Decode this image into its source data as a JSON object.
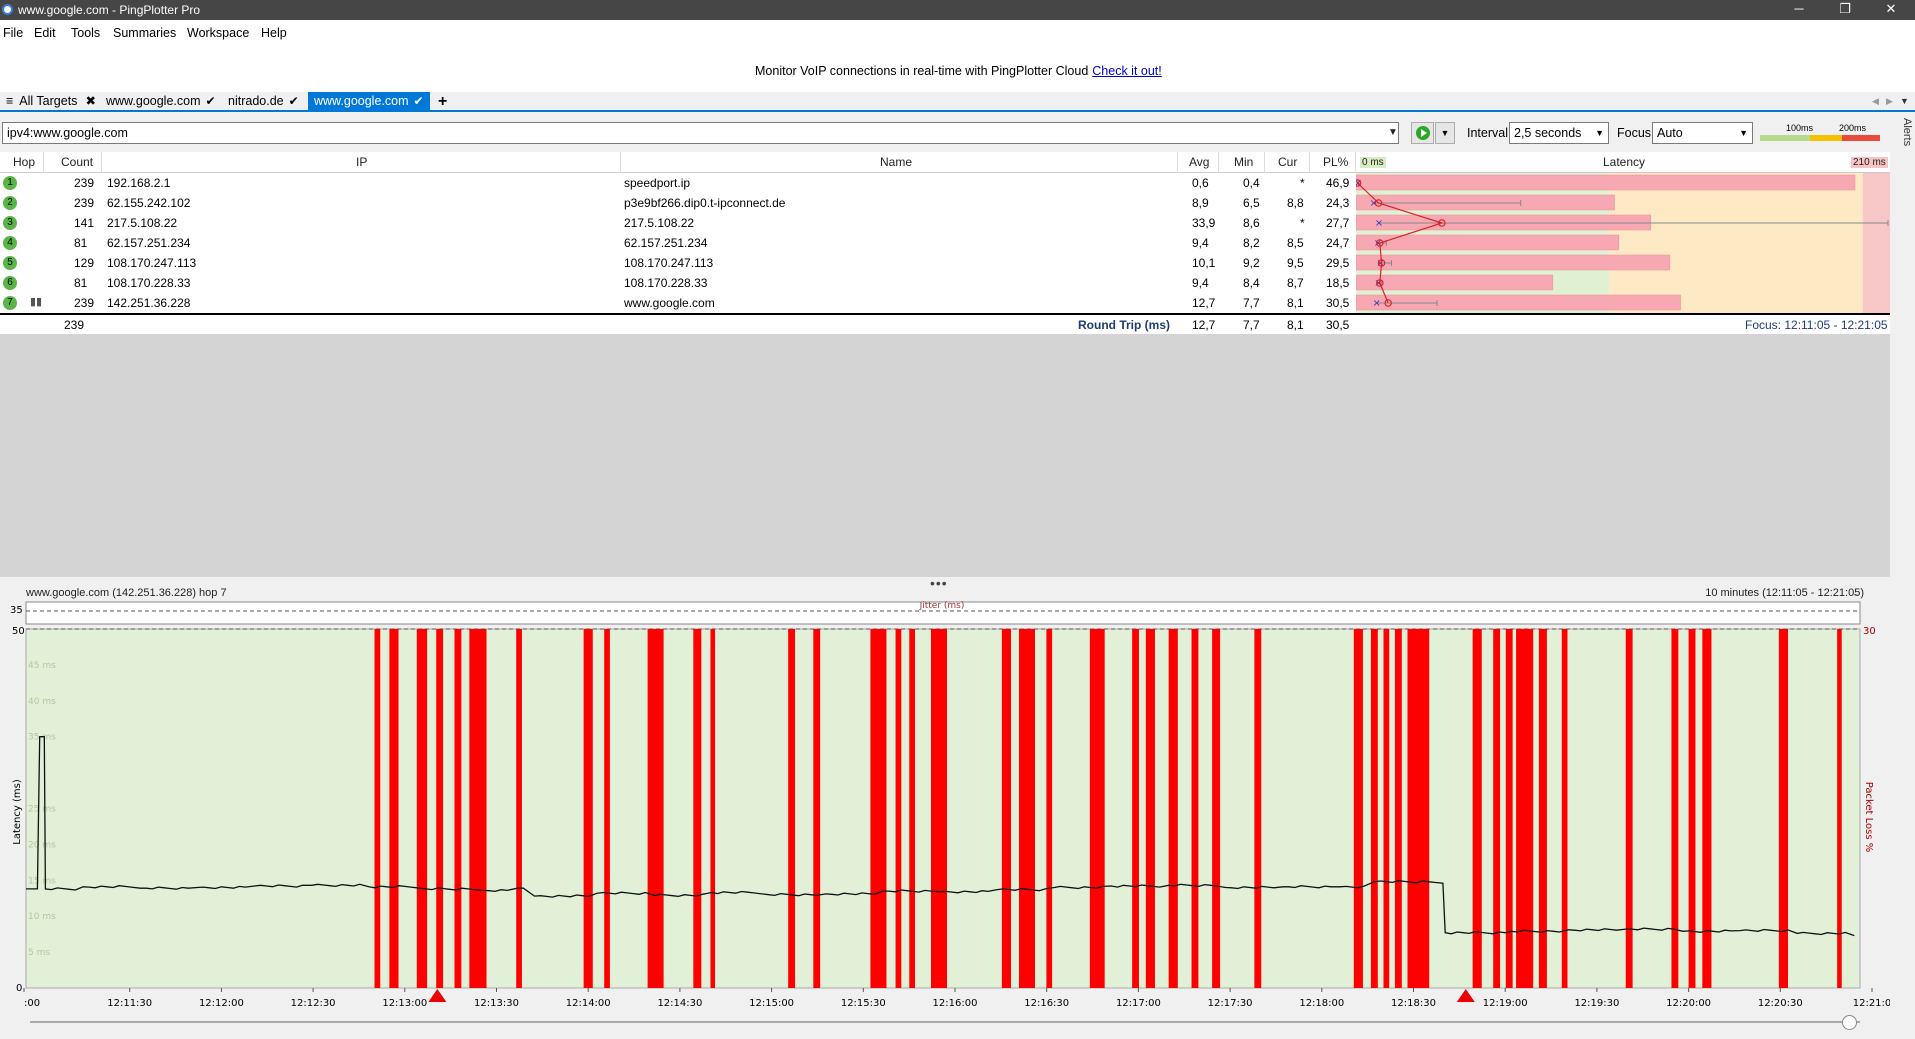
{
  "window": {
    "title": "www.google.com - PingPlotter Pro",
    "minimize": "─",
    "maximize": "❐",
    "close": "✕"
  },
  "menu": [
    "File",
    "Edit",
    "Tools",
    "Summaries",
    "Workspace",
    "Help"
  ],
  "banner": {
    "text": "Monitor VoIP connections in real-time with PingPlotter Cloud",
    "link": "Check it out!"
  },
  "tabs": {
    "all_targets": "All Targets",
    "items": [
      {
        "label": "www.google.com",
        "active": false
      },
      {
        "label": "nitrado.de",
        "active": false
      },
      {
        "label": "www.google.com",
        "active": true
      }
    ],
    "add": "+"
  },
  "target": {
    "value": "ipv4:www.google.com",
    "interval_label": "Interval",
    "interval_value": "2,5 seconds",
    "focus_label": "Focus",
    "focus_value": "Auto",
    "legend_100": "100ms",
    "legend_200": "200ms"
  },
  "alerts_label": "Alerts",
  "table": {
    "headers": {
      "hop": "Hop",
      "count": "Count",
      "ip": "IP",
      "name": "Name",
      "avg": "Avg",
      "min": "Min",
      "cur": "Cur",
      "pl": "PL%",
      "zero_ms": "0 ms",
      "latency": "Latency",
      "max_ms": "210 ms"
    },
    "rows": [
      {
        "hop": "1",
        "count": "239",
        "ip": "192.168.2.1",
        "name": "speedport.ip",
        "avg": "0,6",
        "min": "0,4",
        "cur": "*",
        "pl": "46,9",
        "avg_ms": 0.6,
        "min_ms": 0.4,
        "max_ms": 1.0,
        "pl_pct": 46.9
      },
      {
        "hop": "2",
        "count": "239",
        "ip": "62.155.242.102",
        "name": "p3e9bf266.dip0.t-ipconnect.de",
        "avg": "8,9",
        "min": "6,5",
        "cur": "8,8",
        "pl": "24,3",
        "avg_ms": 8.9,
        "min_ms": 6.5,
        "max_ms": 65,
        "pl_pct": 24.3
      },
      {
        "hop": "3",
        "count": "141",
        "ip": "217.5.108.22",
        "name": "217.5.108.22",
        "avg": "33,9",
        "min": "8,6",
        "cur": "*",
        "pl": "27,7",
        "avg_ms": 33.9,
        "min_ms": 8.6,
        "max_ms": 210,
        "pl_pct": 27.7
      },
      {
        "hop": "4",
        "count": "81",
        "ip": "62.157.251.234",
        "name": "62.157.251.234",
        "avg": "9,4",
        "min": "8,2",
        "cur": "8,5",
        "pl": "24,7",
        "avg_ms": 9.4,
        "min_ms": 8.2,
        "max_ms": 12,
        "pl_pct": 24.7
      },
      {
        "hop": "5",
        "count": "129",
        "ip": "108.170.247.113",
        "name": "108.170.247.113",
        "avg": "10,1",
        "min": "9,2",
        "cur": "9,5",
        "pl": "29,5",
        "avg_ms": 10.1,
        "min_ms": 9.2,
        "max_ms": 14,
        "pl_pct": 29.5
      },
      {
        "hop": "6",
        "count": "81",
        "ip": "108.170.228.33",
        "name": "108.170.228.33",
        "avg": "9,4",
        "min": "8,4",
        "cur": "8,7",
        "pl": "18,5",
        "avg_ms": 9.4,
        "min_ms": 8.4,
        "max_ms": 10,
        "pl_pct": 18.5
      },
      {
        "hop": "7",
        "count": "239",
        "ip": "142.251.36.228",
        "name": "www.google.com",
        "avg": "12,7",
        "min": "7,7",
        "cur": "8,1",
        "pl": "30,5",
        "avg_ms": 12.7,
        "min_ms": 7.7,
        "max_ms": 32,
        "pl_pct": 30.5
      }
    ],
    "total": {
      "count": "239",
      "label": "Round Trip (ms)",
      "avg": "12,7",
      "min": "7,7",
      "cur": "8,1",
      "pl": "30,5",
      "focus": "Focus: 12:11:05 - 12:21:05"
    }
  },
  "graph": {
    "title": "www.google.com (142.251.36.228) hop 7",
    "range": "10 minutes (12:11:05 - 12:21:05)",
    "jitter_label": "Jitter (ms)",
    "jitter_max": "35",
    "latency_axis_label": "Latency (ms)",
    "pl_axis_label": "Packet Loss %",
    "pl_axis_max": "30",
    "y_ticks": [
      "50",
      "0"
    ],
    "y_minor": [
      "45 ms",
      "40 ms",
      "35 ms",
      "25 ms",
      "20 ms",
      "15 ms",
      "10 ms",
      "5 ms"
    ],
    "x_labels": [
      ":00",
      "12:11:30",
      "12:12:00",
      "12:12:30",
      "12:13:00",
      "12:13:30",
      "12:14:00",
      "12:14:30",
      "12:15:00",
      "12:15:30",
      "12:16:00",
      "12:16:30",
      "12:17:00",
      "12:17:30",
      "12:18:00",
      "12:18:30",
      "12:19:00",
      "12:19:30",
      "12:20:00",
      "12:20:30",
      "12:21:0"
    ]
  },
  "chart_data": {
    "type": "bar",
    "title": "www.google.com (142.251.36.228) hop 7",
    "xlabel": "",
    "ylabel": "Latency (ms)",
    "ylim": [
      0,
      50
    ],
    "x_range": [
      "12:11:05",
      "12:21:05"
    ],
    "loss_events_seconds": [
      [
        30.5,
        31
      ],
      [
        31.8,
        32.6
      ],
      [
        34.2,
        35.1
      ],
      [
        35.9,
        36.5
      ],
      [
        37.5,
        38.1
      ],
      [
        38.8,
        40.3
      ],
      [
        42.9,
        43.4
      ],
      [
        48.8,
        49.6
      ],
      [
        50.6,
        51.1
      ],
      [
        54.4,
        55.8
      ],
      [
        58.4,
        59.1
      ],
      [
        59.9,
        60.3
      ],
      [
        66.7,
        67.3
      ],
      [
        68.9,
        69.5
      ],
      [
        73.9,
        75.3
      ],
      [
        76.1,
        76.6
      ],
      [
        77.3,
        77.8
      ],
      [
        79.2,
        80.6
      ],
      [
        85.4,
        86.2
      ],
      [
        86.9,
        88.3
      ],
      [
        89.3,
        89.8
      ],
      [
        93.1,
        94.4
      ],
      [
        96.8,
        97.4
      ],
      [
        98.0,
        98.8
      ],
      [
        100.0,
        100.8
      ],
      [
        102.0,
        102.6
      ],
      [
        103.8,
        104.5
      ],
      [
        107.5,
        108.1
      ],
      [
        116.2,
        117.0
      ],
      [
        117.7,
        118.3
      ],
      [
        118.8,
        119.3
      ],
      [
        119.8,
        120.4
      ],
      [
        120.9,
        122.8
      ],
      [
        126.6,
        127.4
      ],
      [
        128.4,
        129.0
      ],
      [
        129.5,
        130.1
      ],
      [
        130.4,
        131.9
      ],
      [
        132.4,
        133.1
      ],
      [
        134.4,
        134.9
      ],
      [
        140.0,
        140.6
      ],
      [
        144.0,
        144.6
      ],
      [
        145.5,
        146.1
      ],
      [
        146.7,
        147.5
      ],
      [
        153.4,
        154.2
      ],
      [
        158.5,
        158.9
      ]
    ],
    "latency_series": {
      "name": "",
      "points": [
        [
          0,
          13.8
        ],
        [
          1,
          13.8
        ],
        [
          1.2,
          35
        ],
        [
          1.6,
          35
        ],
        [
          1.7,
          13.8
        ],
        [
          5,
          14.1
        ],
        [
          10,
          13.9
        ],
        [
          15,
          14.0
        ],
        [
          20,
          14.2
        ],
        [
          25,
          14.3
        ],
        [
          30,
          14.1
        ],
        [
          35,
          13.8
        ],
        [
          40,
          13.6
        ],
        [
          43,
          13.9
        ],
        [
          44.5,
          12.8
        ],
        [
          50,
          13.2
        ],
        [
          55,
          12.9
        ],
        [
          60,
          13.3
        ],
        [
          65,
          13.0
        ],
        [
          70,
          13.1
        ],
        [
          75,
          13.5
        ],
        [
          80,
          13.4
        ],
        [
          85,
          13.7
        ],
        [
          90,
          14.0
        ],
        [
          95,
          14.2
        ],
        [
          100,
          14.3
        ],
        [
          105,
          14.0
        ],
        [
          110,
          14.1
        ],
        [
          115,
          14.1
        ],
        [
          118,
          14.8
        ],
        [
          124,
          14.6
        ],
        [
          124.2,
          7.7
        ],
        [
          130,
          7.9
        ],
        [
          135,
          8.1
        ],
        [
          140,
          8.2
        ],
        [
          145,
          7.9
        ],
        [
          150,
          8.0
        ],
        [
          155,
          7.6
        ],
        [
          160,
          7.3
        ]
      ]
    },
    "markers_seconds": [
      36,
      126
    ]
  }
}
